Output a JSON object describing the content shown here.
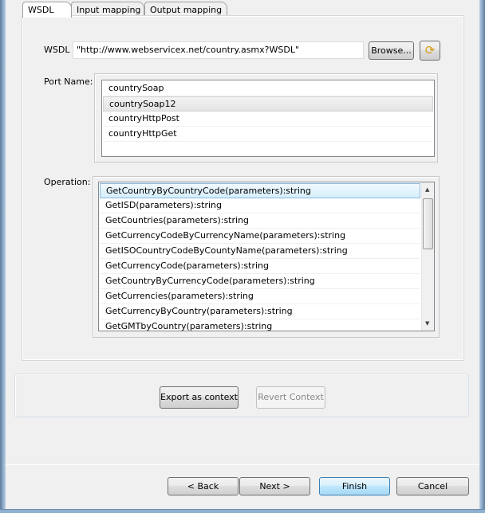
{
  "tabs": [
    {
      "label": "WSDL",
      "active": true
    },
    {
      "label": "Input mapping"
    },
    {
      "label": "Output mapping"
    }
  ],
  "wsdl": {
    "label": "WSDL",
    "value": "\"http://www.webservicex.net/country.asmx?WSDL\"",
    "browse_label": "Browse...",
    "refresh_icon": "refresh-icon"
  },
  "port": {
    "label": "Port Name:",
    "items": [
      "countrySoap",
      "countrySoap12",
      "countryHttpPost",
      "countryHttpGet"
    ],
    "selected": "countrySoap12"
  },
  "operation": {
    "label": "Operation:",
    "items": [
      "GetCountryByCountryCode(parameters):string",
      "GetISD(parameters):string",
      "GetCountries(parameters):string",
      "GetCurrencyCodeByCurrencyName(parameters):string",
      "GetISOCountryCodeByCountyName(parameters):string",
      "GetCurrencyCode(parameters):string",
      "GetCountryByCurrencyCode(parameters):string",
      "GetCurrencies(parameters):string",
      "GetCurrencyByCountry(parameters):string",
      "GetGMTbyCountry(parameters):string"
    ],
    "selected": "GetCountryByCountryCode(parameters):string"
  },
  "context": {
    "export_label": "Export as context",
    "revert_label": "Revert Context"
  },
  "footer": {
    "back": "< Back",
    "next": "Next >",
    "finish": "Finish",
    "cancel": "Cancel"
  }
}
